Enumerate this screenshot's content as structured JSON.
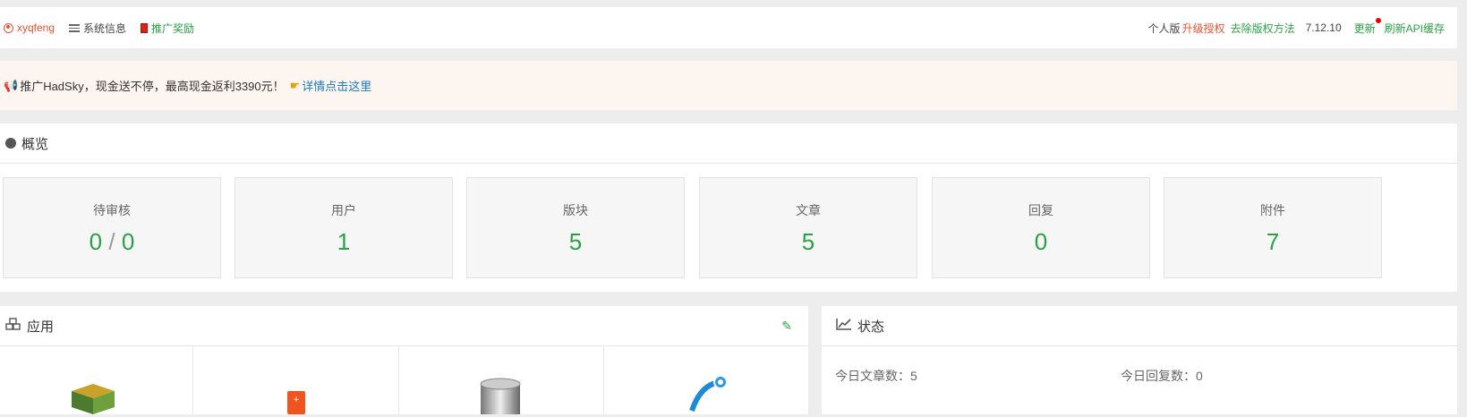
{
  "topbar": {
    "user": "xyqfeng",
    "sys_info": "系统信息",
    "promo_reward": "推广奖励",
    "edition": "个人版",
    "upgrade": "升级授权",
    "remove_copyright": "去除版权方法",
    "version": "7.12.10",
    "update": "更新",
    "refresh_api": "刷新API缓存"
  },
  "promo": {
    "text": "推广HadSky，现金送不停，最高现金返利3390元！",
    "link": "详情点击这里"
  },
  "overview": {
    "title": "概览",
    "stats": [
      {
        "label": "待审核",
        "value_a": "0",
        "sep": "/",
        "value_b": "0"
      },
      {
        "label": "用户",
        "value": "1"
      },
      {
        "label": "版块",
        "value": "5"
      },
      {
        "label": "文章",
        "value": "5"
      },
      {
        "label": "回复",
        "value": "0"
      },
      {
        "label": "附件",
        "value": "7"
      }
    ]
  },
  "apps": {
    "title": "应用"
  },
  "status": {
    "title": "状态",
    "today_articles": "今日文章数：5",
    "today_replies": "今日回复数：0"
  },
  "colors": {
    "accent_green": "#2aa244",
    "accent_red": "#e8522e",
    "link_blue": "#1a79c4"
  }
}
